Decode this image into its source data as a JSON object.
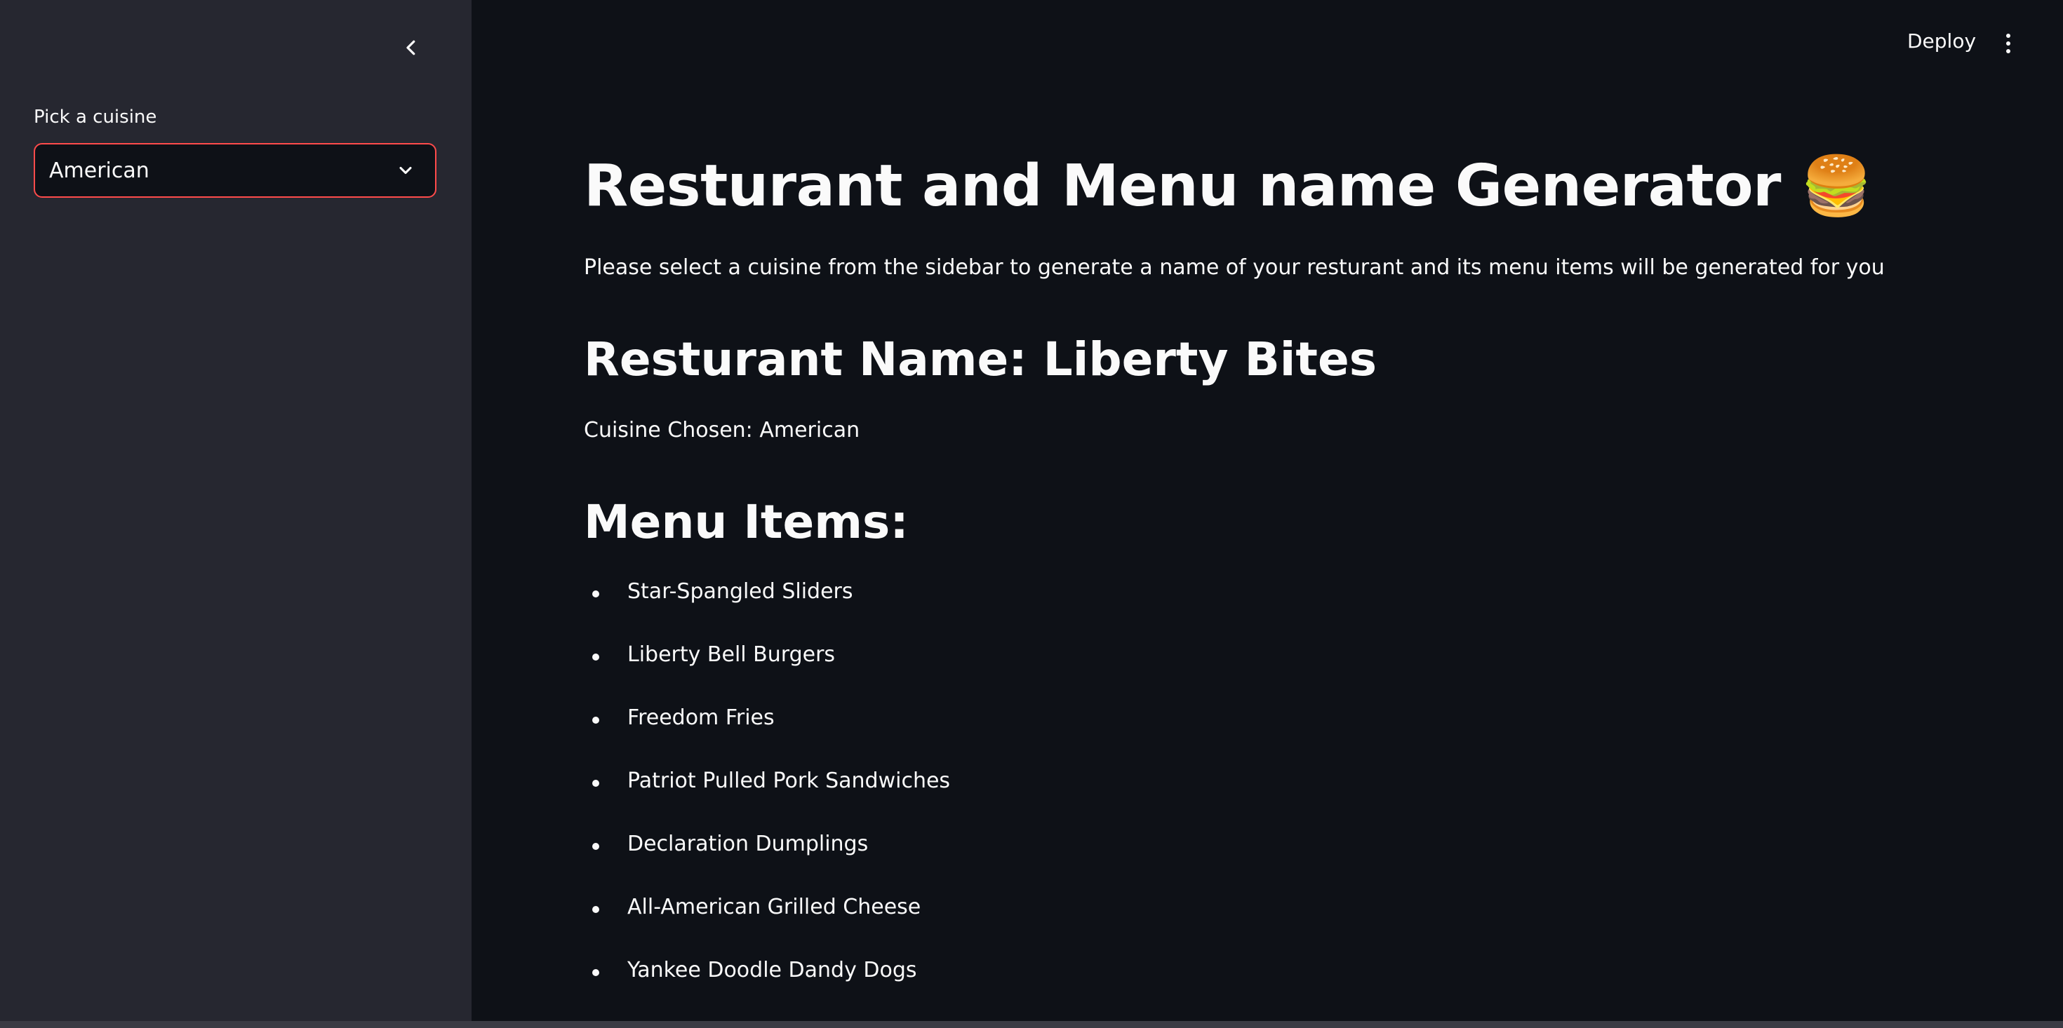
{
  "sidebar": {
    "select_label": "Pick a cuisine",
    "select_value": "American"
  },
  "header": {
    "deploy_label": "Deploy"
  },
  "main": {
    "title": "Resturant and Menu name Generator",
    "title_emoji": "🍔",
    "intro": "Please select a cuisine from the sidebar to generate a name of your resturant and its menu items will be generated for you",
    "restaurant_name": "Resturant Name: Liberty Bites",
    "cuisine_chosen": "Cuisine Chosen: American",
    "menu_heading": "Menu Items:",
    "menu_items": [
      "Star-Spangled Sliders",
      "Liberty Bell Burgers",
      "Freedom Fries",
      "Patriot Pulled Pork Sandwiches",
      "Declaration Dumplings",
      "All-American Grilled Cheese",
      "Yankee Doodle Dandy Dogs"
    ]
  },
  "icons": {
    "collapse": "chevron-left-icon",
    "select_arrow": "chevron-down-icon",
    "menu": "more-vertical-icon"
  },
  "colors": {
    "background": "#0e1117",
    "sidebar": "#262730",
    "accent": "#ff4b4b",
    "text": "#fafafa"
  }
}
